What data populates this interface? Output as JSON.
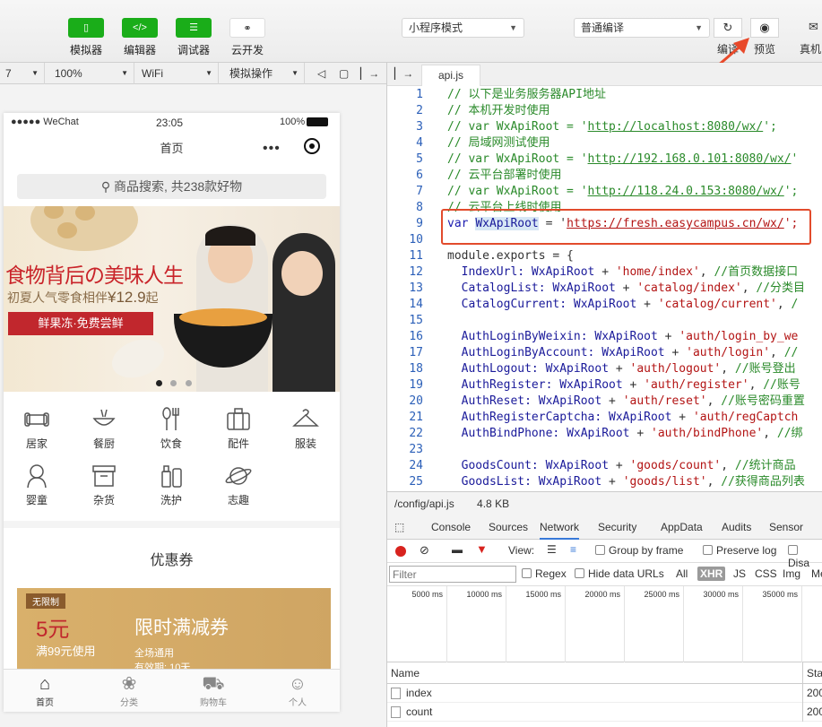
{
  "toolbar": {
    "simulator": "模拟器",
    "editor": "编辑器",
    "debugger": "调试器",
    "cloud": "云开发",
    "mode": "小程序模式",
    "compile_mode": "普通编译",
    "compile": "编译",
    "preview": "预览",
    "real_device": "真机"
  },
  "simbar": {
    "device": "7",
    "zoom": "100%",
    "network": "WiFi",
    "operation": "模拟操作"
  },
  "phone": {
    "carrier": "●●●●● WeChat",
    "time": "23:05",
    "battery": "100%",
    "nav_title": "首页",
    "search_placeholder": "商品搜索, 共238款好物",
    "banner": {
      "headline": "食物背后の美味人生",
      "sub": "初夏人气零食相伴",
      "price": "¥12.9",
      "price_suffix": "起",
      "cta": "鲜果冻·免费尝鲜"
    },
    "categories": [
      {
        "label": "居家",
        "icon": "sofa-icon"
      },
      {
        "label": "餐厨",
        "icon": "bowl-icon"
      },
      {
        "label": "饮食",
        "icon": "utensils-icon"
      },
      {
        "label": "配件",
        "icon": "suitcase-icon"
      },
      {
        "label": "服装",
        "icon": "hanger-icon"
      },
      {
        "label": "婴童",
        "icon": "baby-icon"
      },
      {
        "label": "杂货",
        "icon": "box-icon"
      },
      {
        "label": "洗护",
        "icon": "bottle-icon"
      },
      {
        "label": "志趣",
        "icon": "planet-icon"
      }
    ],
    "coupon": {
      "section_title": "优惠券",
      "tag": "无限制",
      "amount": "5元",
      "condition": "满99元使用",
      "title": "限时满减券",
      "scope": "全场通用",
      "validity": "有效期: 10天"
    },
    "tabs": [
      {
        "label": "首页",
        "icon": "home-icon"
      },
      {
        "label": "分类",
        "icon": "category-icon"
      },
      {
        "label": "购物车",
        "icon": "cart-icon"
      },
      {
        "label": "个人",
        "icon": "user-icon"
      }
    ]
  },
  "editor": {
    "tab": "api.js",
    "lines": [
      {
        "n": "1",
        "parts": [
          {
            "t": "// 以下是业务服务器API地址",
            "c": "cm"
          }
        ]
      },
      {
        "n": "2",
        "parts": [
          {
            "t": "// 本机开发时使用",
            "c": "cm"
          }
        ]
      },
      {
        "n": "3",
        "parts": [
          {
            "t": "// var WxApiRoot = '",
            "c": "cm"
          },
          {
            "t": "http://localhost:8080/wx/",
            "c": "cm url"
          },
          {
            "t": "';",
            "c": "cm"
          }
        ]
      },
      {
        "n": "4",
        "parts": [
          {
            "t": "// 局域网测试使用",
            "c": "cm"
          }
        ]
      },
      {
        "n": "5",
        "parts": [
          {
            "t": "// var WxApiRoot = '",
            "c": "cm"
          },
          {
            "t": "http://192.168.0.101:8080/wx/",
            "c": "cm url"
          },
          {
            "t": "'",
            "c": "cm"
          }
        ]
      },
      {
        "n": "6",
        "parts": [
          {
            "t": "// 云平台部署时使用",
            "c": "cm"
          }
        ]
      },
      {
        "n": "7",
        "parts": [
          {
            "t": "// var WxApiRoot = '",
            "c": "cm"
          },
          {
            "t": "http://118.24.0.153:8080/wx/",
            "c": "cm url"
          },
          {
            "t": "';",
            "c": "cm"
          }
        ]
      },
      {
        "n": "8",
        "parts": [
          {
            "t": "// 云平台上线时使用",
            "c": "cm"
          }
        ]
      },
      {
        "n": "9",
        "parts": [
          {
            "t": "var ",
            "c": "kw"
          },
          {
            "t": "WxApiRoot",
            "c": "var hl"
          },
          {
            "t": " = '",
            "c": ""
          },
          {
            "t": "https://fresh.easycampus.cn/wx/",
            "c": "str url"
          },
          {
            "t": "';",
            "c": "str"
          }
        ]
      },
      {
        "n": "10",
        "parts": []
      },
      {
        "n": "11",
        "parts": [
          {
            "t": "module.exports = {",
            "c": ""
          }
        ]
      },
      {
        "n": "12",
        "parts": [
          {
            "t": "  IndexUrl: ",
            "c": "var"
          },
          {
            "t": "WxApiRoot",
            "c": "var"
          },
          {
            "t": " + ",
            "c": ""
          },
          {
            "t": "'home/index'",
            "c": "str"
          },
          {
            "t": ", ",
            "c": ""
          },
          {
            "t": "//首页数据接口",
            "c": "cm"
          }
        ]
      },
      {
        "n": "13",
        "parts": [
          {
            "t": "  CatalogList: ",
            "c": "var"
          },
          {
            "t": "WxApiRoot",
            "c": "var"
          },
          {
            "t": " + ",
            "c": ""
          },
          {
            "t": "'catalog/index'",
            "c": "str"
          },
          {
            "t": ", ",
            "c": ""
          },
          {
            "t": "//分类目",
            "c": "cm"
          }
        ]
      },
      {
        "n": "14",
        "parts": [
          {
            "t": "  CatalogCurrent: ",
            "c": "var"
          },
          {
            "t": "WxApiRoot",
            "c": "var"
          },
          {
            "t": " + ",
            "c": ""
          },
          {
            "t": "'catalog/current'",
            "c": "str"
          },
          {
            "t": ", ",
            "c": ""
          },
          {
            "t": "/",
            "c": "cm"
          }
        ]
      },
      {
        "n": "15",
        "parts": []
      },
      {
        "n": "16",
        "parts": [
          {
            "t": "  AuthLoginByWeixin: ",
            "c": "var"
          },
          {
            "t": "WxApiRoot",
            "c": "var"
          },
          {
            "t": " + ",
            "c": ""
          },
          {
            "t": "'auth/login_by_we",
            "c": "str"
          }
        ]
      },
      {
        "n": "17",
        "parts": [
          {
            "t": "  AuthLoginByAccount: ",
            "c": "var"
          },
          {
            "t": "WxApiRoot",
            "c": "var"
          },
          {
            "t": " + ",
            "c": ""
          },
          {
            "t": "'auth/login'",
            "c": "str"
          },
          {
            "t": ", ",
            "c": ""
          },
          {
            "t": "//",
            "c": "cm"
          }
        ]
      },
      {
        "n": "18",
        "parts": [
          {
            "t": "  AuthLogout: ",
            "c": "var"
          },
          {
            "t": "WxApiRoot",
            "c": "var"
          },
          {
            "t": " + ",
            "c": ""
          },
          {
            "t": "'auth/logout'",
            "c": "str"
          },
          {
            "t": ", ",
            "c": ""
          },
          {
            "t": "//账号登出",
            "c": "cm"
          }
        ]
      },
      {
        "n": "19",
        "parts": [
          {
            "t": "  AuthRegister: ",
            "c": "var"
          },
          {
            "t": "WxApiRoot",
            "c": "var"
          },
          {
            "t": " + ",
            "c": ""
          },
          {
            "t": "'auth/register'",
            "c": "str"
          },
          {
            "t": ", ",
            "c": ""
          },
          {
            "t": "//账号",
            "c": "cm"
          }
        ]
      },
      {
        "n": "20",
        "parts": [
          {
            "t": "  AuthReset: ",
            "c": "var"
          },
          {
            "t": "WxApiRoot",
            "c": "var"
          },
          {
            "t": " + ",
            "c": ""
          },
          {
            "t": "'auth/reset'",
            "c": "str"
          },
          {
            "t": ", ",
            "c": ""
          },
          {
            "t": "//账号密码重置",
            "c": "cm"
          }
        ]
      },
      {
        "n": "21",
        "parts": [
          {
            "t": "  AuthRegisterCaptcha: ",
            "c": "var"
          },
          {
            "t": "WxApiRoot",
            "c": "var"
          },
          {
            "t": " + ",
            "c": ""
          },
          {
            "t": "'auth/regCaptch",
            "c": "str"
          }
        ]
      },
      {
        "n": "22",
        "parts": [
          {
            "t": "  AuthBindPhone: ",
            "c": "var"
          },
          {
            "t": "WxApiRoot",
            "c": "var"
          },
          {
            "t": " + ",
            "c": ""
          },
          {
            "t": "'auth/bindPhone'",
            "c": "str"
          },
          {
            "t": ", ",
            "c": ""
          },
          {
            "t": "//绑",
            "c": "cm"
          }
        ]
      },
      {
        "n": "23",
        "parts": []
      },
      {
        "n": "24",
        "parts": [
          {
            "t": "  GoodsCount: ",
            "c": "var"
          },
          {
            "t": "WxApiRoot",
            "c": "var"
          },
          {
            "t": " + ",
            "c": ""
          },
          {
            "t": "'goods/count'",
            "c": "str"
          },
          {
            "t": ", ",
            "c": ""
          },
          {
            "t": "//统计商品",
            "c": "cm"
          }
        ]
      },
      {
        "n": "25",
        "parts": [
          {
            "t": "  GoodsList: ",
            "c": "var"
          },
          {
            "t": "WxApiRoot",
            "c": "var"
          },
          {
            "t": " + ",
            "c": ""
          },
          {
            "t": "'goods/list'",
            "c": "str"
          },
          {
            "t": ", ",
            "c": ""
          },
          {
            "t": "//获得商品列表",
            "c": "cm"
          }
        ]
      }
    ]
  },
  "pathbar": {
    "path": "/config/api.js",
    "size": "4.8 KB"
  },
  "devtools": {
    "tabs": [
      "Console",
      "Sources",
      "Network",
      "Security",
      "AppData",
      "Audits",
      "Sensor"
    ],
    "active_tab": "Network",
    "view_label": "View:",
    "group_by_frame": "Group by frame",
    "preserve_log": "Preserve log",
    "disable_cache": "Disa",
    "filter_placeholder": "Filter",
    "regex": "Regex",
    "hide_data_urls": "Hide data URLs",
    "types": [
      "All",
      "XHR",
      "JS",
      "CSS",
      "Img",
      "Me"
    ],
    "active_type": "XHR",
    "ticks": [
      "5000 ms",
      "10000 ms",
      "15000 ms",
      "20000 ms",
      "25000 ms",
      "30000 ms",
      "35000 ms",
      "4"
    ],
    "col_name": "Name",
    "col_status": "Stat",
    "requests": [
      {
        "name": "index",
        "status": "200"
      },
      {
        "name": "count",
        "status": "200"
      }
    ]
  }
}
